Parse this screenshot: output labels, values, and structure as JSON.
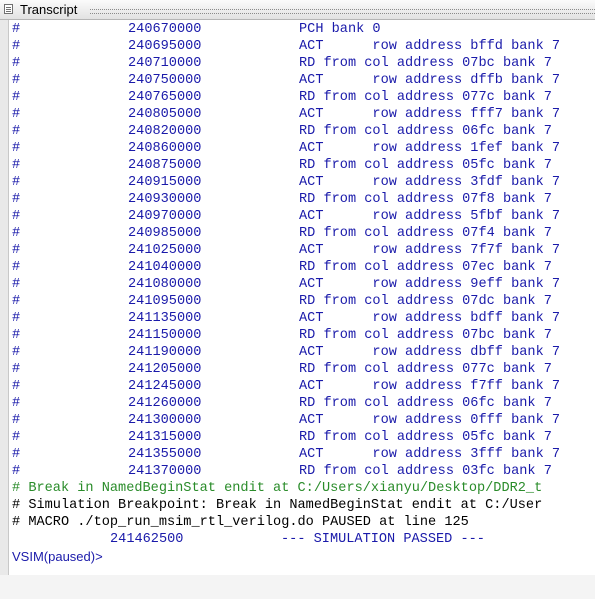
{
  "window": {
    "title": "Transcript"
  },
  "rows": [
    {
      "time": "240670000",
      "cmd": "PCH bank 0"
    },
    {
      "time": "240695000",
      "cmd": "ACT      row address bffd bank 7"
    },
    {
      "time": "240710000",
      "cmd": "RD from col address 07bc bank 7"
    },
    {
      "time": "240750000",
      "cmd": "ACT      row address dffb bank 7"
    },
    {
      "time": "240765000",
      "cmd": "RD from col address 077c bank 7"
    },
    {
      "time": "240805000",
      "cmd": "ACT      row address fff7 bank 7"
    },
    {
      "time": "240820000",
      "cmd": "RD from col address 06fc bank 7"
    },
    {
      "time": "240860000",
      "cmd": "ACT      row address 1fef bank 7"
    },
    {
      "time": "240875000",
      "cmd": "RD from col address 05fc bank 7"
    },
    {
      "time": "240915000",
      "cmd": "ACT      row address 3fdf bank 7"
    },
    {
      "time": "240930000",
      "cmd": "RD from col address 07f8 bank 7"
    },
    {
      "time": "240970000",
      "cmd": "ACT      row address 5fbf bank 7"
    },
    {
      "time": "240985000",
      "cmd": "RD from col address 07f4 bank 7"
    },
    {
      "time": "241025000",
      "cmd": "ACT      row address 7f7f bank 7"
    },
    {
      "time": "241040000",
      "cmd": "RD from col address 07ec bank 7"
    },
    {
      "time": "241080000",
      "cmd": "ACT      row address 9eff bank 7"
    },
    {
      "time": "241095000",
      "cmd": "RD from col address 07dc bank 7"
    },
    {
      "time": "241135000",
      "cmd": "ACT      row address bdff bank 7"
    },
    {
      "time": "241150000",
      "cmd": "RD from col address 07bc bank 7"
    },
    {
      "time": "241190000",
      "cmd": "ACT      row address dbff bank 7"
    },
    {
      "time": "241205000",
      "cmd": "RD from col address 077c bank 7"
    },
    {
      "time": "241245000",
      "cmd": "ACT      row address f7ff bank 7"
    },
    {
      "time": "241260000",
      "cmd": "RD from col address 06fc bank 7"
    },
    {
      "time": "241300000",
      "cmd": "ACT      row address 0fff bank 7"
    },
    {
      "time": "241315000",
      "cmd": "RD from col address 05fc bank 7"
    },
    {
      "time": "241355000",
      "cmd": "ACT      row address 3fff bank 7"
    },
    {
      "time": "241370000",
      "cmd": "RD from col address 03fc bank 7"
    }
  ],
  "messages": {
    "break_line": "# Break in NamedBeginStat endit at C:/Users/xianyu/Desktop/DDR2_t",
    "sim_breakpoint": "# Simulation Breakpoint: Break in NamedBeginStat endit at C:/User",
    "macro": "# MACRO ./top_run_msim_rtl_verilog.do PAUSED at line 125",
    "final_time": "241462500",
    "final_status": "--- SIMULATION PASSED ---",
    "prompt": "VSIM(paused)>"
  },
  "colors": {
    "text_blue": "#1a1aaa",
    "comment_green": "#2a8c2a"
  }
}
